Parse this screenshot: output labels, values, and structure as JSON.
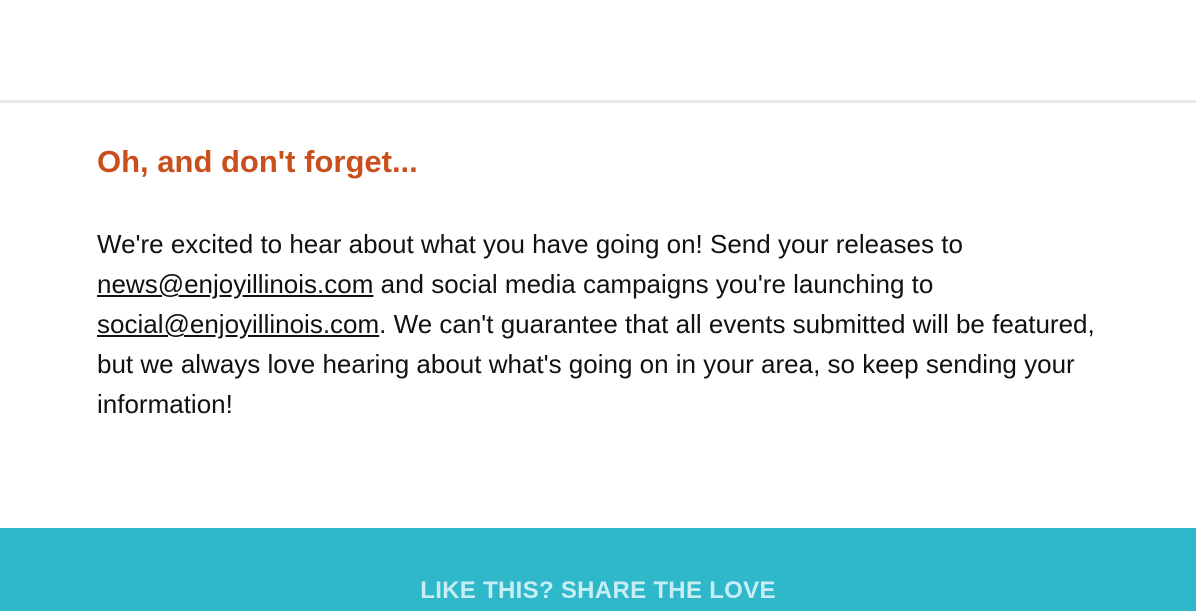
{
  "section": {
    "heading": "Oh, and don't forget...",
    "paragraph": {
      "part1": "We're excited to hear about what you have going on! Send your releases to ",
      "news_email": "news@enjoyillinois.com",
      "part2": " and social media campaigns you're launching to ",
      "social_email": "social@enjoyillinois.com",
      "part3": ". We can't guarantee that all events submitted will be featured, but we always love hearing about what's going on in your area, so keep sending your information!"
    }
  },
  "share": {
    "label": "LIKE THIS? SHARE THE LOVE"
  },
  "colors": {
    "heading": "#c9501c",
    "share_band": "#2fb8c9",
    "share_text": "#c7eef4",
    "divider": "#e9e9e9"
  }
}
